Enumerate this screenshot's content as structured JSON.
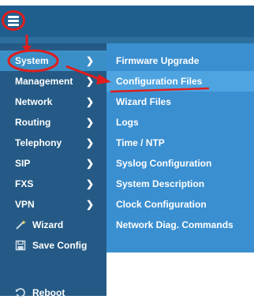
{
  "header": {
    "menu_icon": "hamburger-icon"
  },
  "sidebar": {
    "items": [
      {
        "label": "System",
        "chevron": "❯",
        "active": true
      },
      {
        "label": "Management",
        "chevron": "❯"
      },
      {
        "label": "Network",
        "chevron": "❯"
      },
      {
        "label": "Routing",
        "chevron": "❯"
      },
      {
        "label": "Telephony",
        "chevron": "❯"
      },
      {
        "label": "SIP",
        "chevron": "❯"
      },
      {
        "label": "FXS",
        "chevron": "❯"
      },
      {
        "label": "VPN",
        "chevron": "❯"
      },
      {
        "label": "Wizard",
        "icon": "wand-icon"
      },
      {
        "label": "Save Config",
        "icon": "save-icon"
      },
      {
        "label": "Reboot",
        "icon": "reboot-icon"
      }
    ]
  },
  "submenu": {
    "items": [
      {
        "label": "Firmware Upgrade"
      },
      {
        "label": "Configuration Files",
        "highlight": true
      },
      {
        "label": "Wizard Files"
      },
      {
        "label": "Logs"
      },
      {
        "label": "Time / NTP"
      },
      {
        "label": "Syslog Configuration"
      },
      {
        "label": "System Description"
      },
      {
        "label": "Clock Configuration"
      },
      {
        "label": "Network Diag. Commands"
      }
    ]
  },
  "colors": {
    "header": "#1f5f8f",
    "sidebar": "#245a85",
    "submenu": "#3a8fd0",
    "active": "#3b8fc7",
    "annotation": "#e01d1d"
  }
}
